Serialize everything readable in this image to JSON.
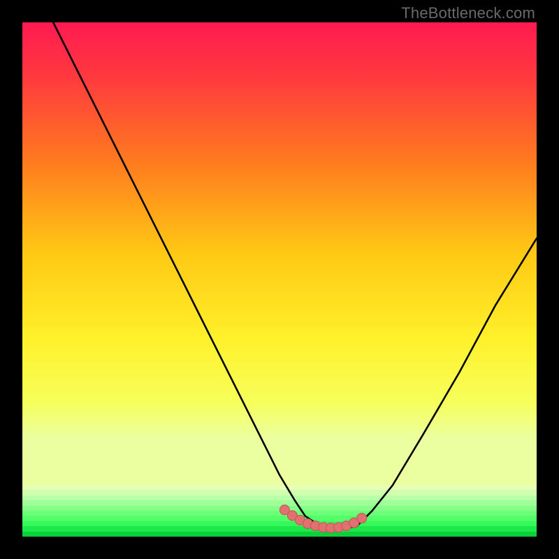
{
  "attribution": "TheBottleneck.com",
  "colors": {
    "bg_black": "#000000",
    "attribution_text": "#6a6a6a",
    "gradient_stops": [
      {
        "offset": "0%",
        "color": "#ff1a52"
      },
      {
        "offset": "12%",
        "color": "#ff3a3e"
      },
      {
        "offset": "30%",
        "color": "#ff7a1f"
      },
      {
        "offset": "50%",
        "color": "#ffc914"
      },
      {
        "offset": "68%",
        "color": "#fff02a"
      },
      {
        "offset": "82%",
        "color": "#f6ff5a"
      },
      {
        "offset": "90%",
        "color": "#ecffa0"
      }
    ],
    "green_bands": [
      "#e6ffb5",
      "#d0ffb0",
      "#b8ffa8",
      "#9fff98",
      "#86ff88",
      "#6cff78",
      "#52ff68",
      "#35f85a",
      "#1ce84a",
      "#0ad03a"
    ],
    "curve_stroke": "#000000",
    "marker_fill": "#e17070",
    "marker_stroke": "#c55858"
  },
  "chart_data": {
    "type": "line",
    "title": "",
    "xlabel": "",
    "ylabel": "",
    "xlim": [
      0,
      100
    ],
    "ylim": [
      0,
      100
    ],
    "series": [
      {
        "name": "curve",
        "x": [
          6,
          10,
          15,
          20,
          25,
          30,
          35,
          40,
          45,
          50,
          53,
          55,
          58,
          60,
          62,
          65,
          68,
          72,
          78,
          85,
          92,
          100
        ],
        "y": [
          100,
          92,
          82,
          72,
          62,
          52,
          42,
          32,
          22,
          12,
          7,
          4,
          2,
          1.5,
          1.5,
          2,
          5,
          10,
          20,
          32,
          45,
          58
        ]
      }
    ],
    "markers": {
      "name": "highlight-band",
      "x": [
        51,
        52.5,
        54,
        55.5,
        57,
        58.5,
        60,
        61.5,
        63,
        64.5,
        66
      ],
      "y": [
        5.2,
        4.1,
        3.2,
        2.5,
        2.1,
        1.8,
        1.7,
        1.8,
        2.1,
        2.7,
        3.6
      ]
    },
    "annotations": [
      {
        "text": "TheBottleneck.com",
        "position": "top-right"
      }
    ]
  }
}
